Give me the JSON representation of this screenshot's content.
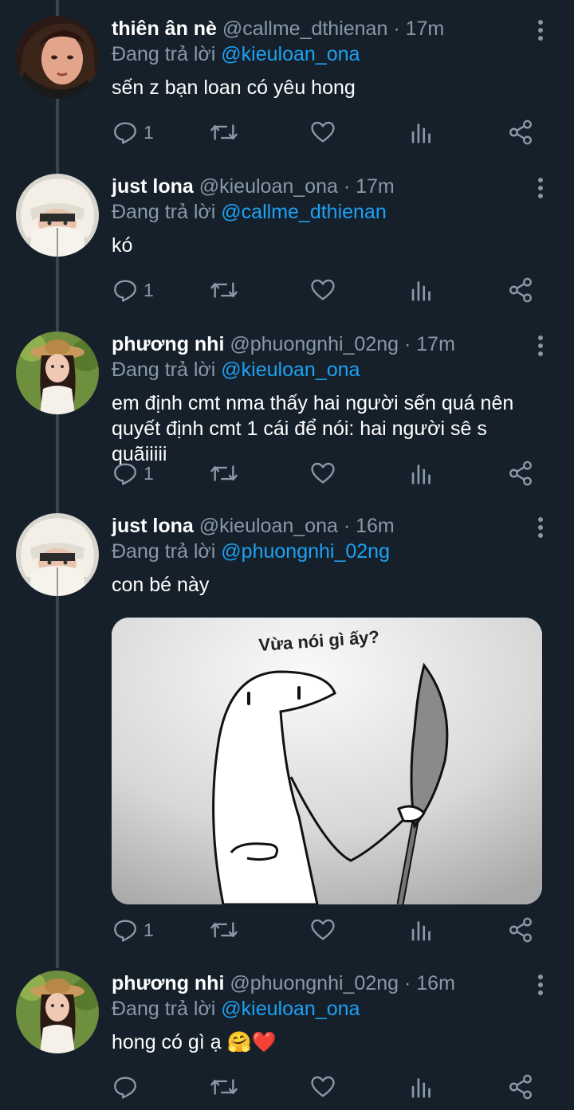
{
  "colors": {
    "background": "#15202b",
    "thread_line": "#38444d",
    "secondary": "#8899a6",
    "mention": "#1da1f2"
  },
  "tweets": [
    {
      "name": "thiên ân nè",
      "meta": "@callme_dthienan · 17m",
      "reply_prefix": "Đang trả lời",
      "reply_to": "@kieuloan_ona",
      "text": "sến z bạn loan có yêu hong",
      "reply_count": "1"
    },
    {
      "name": "just lona",
      "meta": "@kieuloan_ona · 17m",
      "reply_prefix": "Đang trả lời",
      "reply_to": "@callme_dthienan",
      "text": "kó",
      "reply_count": "1"
    },
    {
      "name": "phương nhi",
      "meta": "@phuongnhi_02ng · 17m",
      "reply_prefix": "Đang trả lời",
      "reply_to": "@kieuloan_ona",
      "text_line1": "em định cmt nma thấy hai người sến quá nên",
      "text_line2": "quyết định cmt 1 cái để nói: hai người sê s quãiiiii",
      "reply_count": "1"
    },
    {
      "name": "just lona",
      "meta": "@kieuloan_ona · 16m",
      "reply_prefix": "Đang trả lời",
      "reply_to": "@phuongnhi_02ng",
      "text": "con bé này",
      "media_caption": "Vừa nói gì ấy?",
      "reply_count": "1"
    },
    {
      "name": "phương nhi",
      "meta": "@phuongnhi_02ng · 16m",
      "reply_prefix": "Đang trả lời",
      "reply_to": "@kieuloan_ona",
      "text": "hong có gì ạ",
      "emoji": "🤗❤️",
      "reply_count": ""
    }
  ]
}
